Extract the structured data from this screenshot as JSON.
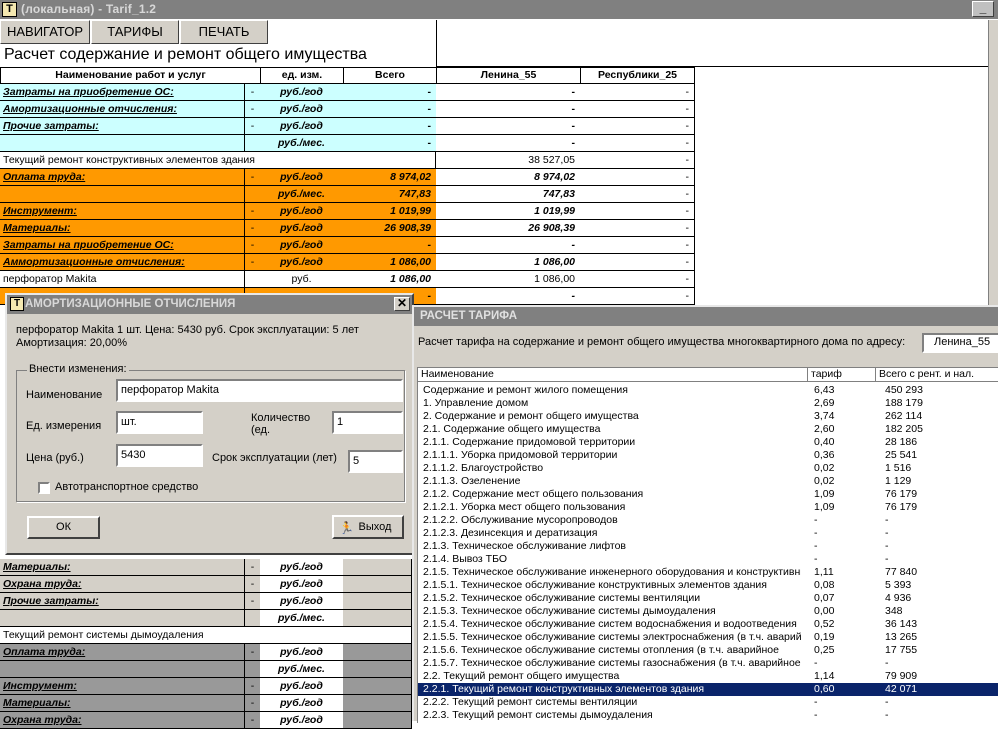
{
  "window": {
    "title": "(локальная) - Tarif_1.2",
    "app_icon": "T",
    "min_label": "_"
  },
  "toolbar": {
    "navigator": "НАВИГАТОР",
    "tariffs": "ТАРИФЫ",
    "print": "ПЕЧАТЬ"
  },
  "sheet": {
    "title": "Расчет содержание и ремонт общего имущества",
    "headers": {
      "name": "Наименование работ и услуг",
      "unit": "ед. изм.",
      "total": "Всего",
      "col1": "Ленина_55",
      "col2": "Республики_25"
    },
    "rows": [
      {
        "name": "Затраты на приобретение ОС:",
        "dash": "-",
        "unit": "руб./год",
        "total": "-",
        "c1": "-",
        "c2": "-"
      },
      {
        "name": "Амортизационные отчисления:",
        "dash": "-",
        "unit": "руб./год",
        "total": "-",
        "c1": "-",
        "c2": "-"
      },
      {
        "name": "Прочие затраты:",
        "dash": "-",
        "unit": "руб./год",
        "total": "-",
        "c1": "-",
        "c2": "-"
      },
      {
        "name": "",
        "dash": "",
        "unit": "руб./мес.",
        "total": "-",
        "c1": "-",
        "c2": "-"
      },
      {
        "name": "Текущий ремонт конструктивных элементов здания",
        "dash": "",
        "unit": "",
        "total": "",
        "c1": "38 527,05",
        "c2": "-"
      },
      {
        "name": "Оплата труда:",
        "dash": "-",
        "unit": "руб./год",
        "total": "8 974,02",
        "c1": "8 974,02",
        "c2": "-"
      },
      {
        "name": "",
        "dash": "",
        "unit": "руб./мес.",
        "total": "747,83",
        "c1": "747,83",
        "c2": "-"
      },
      {
        "name": "Инструмент:",
        "dash": "-",
        "unit": "руб./год",
        "total": "1 019,99",
        "c1": "1 019,99",
        "c2": "-"
      },
      {
        "name": "Материалы:",
        "dash": "-",
        "unit": "руб./год",
        "total": "26 908,39",
        "c1": "26 908,39",
        "c2": "-"
      },
      {
        "name": "Затраты на приобретение ОС:",
        "dash": "-",
        "unit": "руб./год",
        "total": "-",
        "c1": "-",
        "c2": "-"
      },
      {
        "name": "Аммортизационные отчисления:",
        "dash": "-",
        "unit": "руб./год",
        "total": "1 086,00",
        "c1": "1 086,00",
        "c2": "-"
      },
      {
        "name": "перфоратор Makita",
        "dash": "",
        "unit": "руб.",
        "total": "1 086,00",
        "c1": "1 086,00",
        "c2": "-"
      },
      {
        "name": "",
        "dash": "",
        "unit": "",
        "total": "-",
        "c1": "-",
        "c2": "-"
      }
    ],
    "lower_rows": [
      {
        "name": "Материалы:",
        "dash": "-",
        "unit": "руб./год"
      },
      {
        "name": "Охрана труда:",
        "dash": "-",
        "unit": "руб./год"
      },
      {
        "name": "Прочие затраты:",
        "dash": "-",
        "unit": "руб./год"
      },
      {
        "name": "",
        "dash": "",
        "unit": "руб./мес."
      },
      {
        "name": "Текущий ремонт системы дымоудаления",
        "dash": "",
        "unit": ""
      },
      {
        "name": "Оплата труда:",
        "dash": "-",
        "unit": "руб./год"
      },
      {
        "name": "",
        "dash": "",
        "unit": "руб./мес."
      },
      {
        "name": "Инструмент:",
        "dash": "-",
        "unit": "руб./год"
      },
      {
        "name": "Материалы:",
        "dash": "-",
        "unit": "руб./год"
      },
      {
        "name": "Охрана труда:",
        "dash": "-",
        "unit": "руб./год"
      }
    ]
  },
  "dialog": {
    "title": "АМОРТИЗАЦИОННЫЕ ОТЧИСЛЕНИЯ",
    "close": "✕",
    "info_line1": "перфоратор Makita 1 шт. Цена: 5430 руб. Срок эксплуатации: 5 лет",
    "info_line2": "Амортизация: 20,00%",
    "group": "Внести изменения:",
    "name_label": "Наименование",
    "name_value": "перфоратор Makita",
    "unit_label": "Ед. измерения",
    "unit_value": "шт.",
    "qty_label": "Количество (ед.",
    "qty_value": "1",
    "price_label": "Цена (руб.)",
    "price_value": "5430",
    "life_label": "Срок эксплуатации (лет)",
    "life_value": "5",
    "vehicle_label": "Автотранспортное средство",
    "ok": "ОК",
    "exit": "Выход"
  },
  "tariff": {
    "title": "РАСЧЕТ ТАРИФА",
    "prompt": "Расчет тарифа на содержание и ремонт общего имущества многоквартирного дома по адресу:",
    "address": "Ленина_55",
    "columns": [
      "Наименование",
      "тариф",
      "Всего с рент. и нал."
    ],
    "rows": [
      [
        "Содержание и ремонт жилого помещения",
        "6,43",
        "450 293"
      ],
      [
        "1. Управление домом",
        "2,69",
        "188 179"
      ],
      [
        "2. Содержание и ремонт общего имущества",
        "3,74",
        "262 114"
      ],
      [
        "2.1. Содержание общего имущества",
        "2,60",
        "182 205"
      ],
      [
        "2.1.1. Содержание придомовой территории",
        "0,40",
        "28 186"
      ],
      [
        "2.1.1.1. Уборка придомовой территории",
        "0,36",
        "25 541"
      ],
      [
        "2.1.1.2. Благоустройство",
        "0,02",
        "1 516"
      ],
      [
        "2.1.1.3. Озеленение",
        "0,02",
        "1 129"
      ],
      [
        "2.1.2. Содержание мест общего пользования",
        "1,09",
        "76 179"
      ],
      [
        "2.1.2.1. Уборка мест общего пользования",
        "1,09",
        "76 179"
      ],
      [
        "2.1.2.2. Обслуживание мусоропроводов",
        "-",
        "-"
      ],
      [
        "2.1.2.3. Дезинсекция и дератизация",
        "-",
        "-"
      ],
      [
        "2.1.3. Техническое обслуживание лифтов",
        "-",
        "-"
      ],
      [
        "2.1.4. Вывоз ТБО",
        "-",
        "-"
      ],
      [
        "2.1.5. Техническое обслуживание инженерного оборудования и конструктивных",
        "1,11",
        "77 840"
      ],
      [
        "2.1.5.1. Техническое обслуживание конструктивных элементов здания",
        "0,08",
        "5 393"
      ],
      [
        "2.1.5.2. Техническое обслуживание системы вентиляции",
        "0,07",
        "4 936"
      ],
      [
        "2.1.5.3. Техническое обслуживание системы дымоудаления",
        "0,00",
        "348"
      ],
      [
        "2.1.5.4. Техническое обслуживание систем водоснабжения и водоотведения",
        "0,52",
        "36 143"
      ],
      [
        "2.1.5.5. Техническое обслуживание системы электроснабжения (в т.ч. аварийное",
        "0,19",
        "13 265"
      ],
      [
        "2.1.5.6. Техническое обслуживание системы отопления (в т.ч. аварийное",
        "0,25",
        "17 755"
      ],
      [
        "2.1.5.7. Техническое обслуживание системы газоснабжения (в т.ч. аварийное",
        "-",
        "-"
      ],
      [
        "2.2. Текущий ремонт общего имущества",
        "1,14",
        "79 909"
      ],
      [
        "2.2.1. Текущий ремонт конструктивных элементов здания",
        "0,60",
        "42 071"
      ],
      [
        "2.2.2. Текущий ремонт системы вентиляции",
        "-",
        "-"
      ],
      [
        "2.2.3. Текущий ремонт системы дымоудаления",
        "-",
        "-"
      ]
    ],
    "selected_index": 23
  }
}
